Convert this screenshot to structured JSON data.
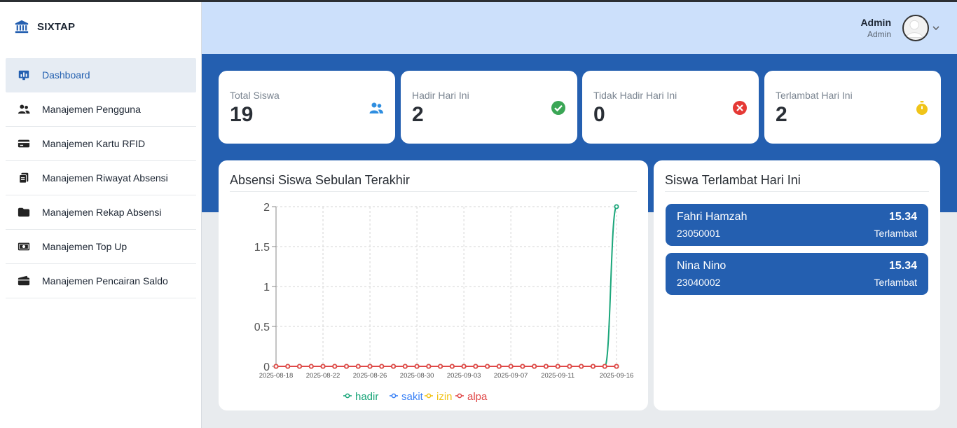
{
  "app": {
    "name": "SIXTAP"
  },
  "sidebar": {
    "items": [
      {
        "label": "Dashboard",
        "icon": "dashboard-chart-icon",
        "active": true
      },
      {
        "label": "Manajemen Pengguna",
        "icon": "users-icon"
      },
      {
        "label": "Manajemen Kartu RFID",
        "icon": "credit-card-icon"
      },
      {
        "label": "Manajemen Riwayat Absensi",
        "icon": "clipboard-history-icon"
      },
      {
        "label": "Manajemen Rekap Absensi",
        "icon": "folder-icon"
      },
      {
        "label": "Manajemen Top Up",
        "icon": "money-bill-icon"
      },
      {
        "label": "Manajemen Pencairan Saldo",
        "icon": "wallet-icon"
      }
    ]
  },
  "header": {
    "user_name": "Admin",
    "user_role": "Admin"
  },
  "stats": [
    {
      "label": "Total Siswa",
      "value": "19",
      "icon": "users-icon",
      "color": "#2f8ee0"
    },
    {
      "label": "Hadir Hari Ini",
      "value": "2",
      "icon": "check-circle-icon",
      "color": "#3aa655"
    },
    {
      "label": "Tidak Hadir Hari Ini",
      "value": "0",
      "icon": "x-circle-icon",
      "color": "#e53935"
    },
    {
      "label": "Terlambat Hari Ini",
      "value": "2",
      "icon": "stopwatch-icon",
      "color": "#f0c419"
    }
  ],
  "attendance_card": {
    "title": "Absensi Siswa Sebulan Terakhir"
  },
  "late_card": {
    "title": "Siswa Terlambat Hari Ini",
    "items": [
      {
        "name": "Fahri Hamzah",
        "id": "23050001",
        "time": "15.34",
        "status": "Terlambat"
      },
      {
        "name": "Nina Nino",
        "id": "23040002",
        "time": "15.34",
        "status": "Terlambat"
      }
    ]
  },
  "chart_data": {
    "type": "line",
    "title": "",
    "xlabel": "",
    "ylabel": "",
    "ylim": [
      0,
      2
    ],
    "y_ticks": [
      "0",
      "0.5",
      "1",
      "1.5",
      "2"
    ],
    "grid": true,
    "legend_position": "bottom",
    "x_tick_labels": [
      "2025-08-18",
      "2025-08-22",
      "2025-08-26",
      "2025-08-30",
      "2025-09-03",
      "2025-09-07",
      "2025-09-11",
      "2025-09-16"
    ],
    "x": [
      "2025-08-18",
      "2025-08-19",
      "2025-08-20",
      "2025-08-21",
      "2025-08-22",
      "2025-08-23",
      "2025-08-24",
      "2025-08-25",
      "2025-08-26",
      "2025-08-27",
      "2025-08-28",
      "2025-08-29",
      "2025-08-30",
      "2025-08-31",
      "2025-09-01",
      "2025-09-02",
      "2025-09-03",
      "2025-09-04",
      "2025-09-05",
      "2025-09-06",
      "2025-09-07",
      "2025-09-08",
      "2025-09-09",
      "2025-09-10",
      "2025-09-11",
      "2025-09-12",
      "2025-09-13",
      "2025-09-14",
      "2025-09-15",
      "2025-09-16"
    ],
    "series": [
      {
        "name": "hadir",
        "color": "#1aa67a",
        "values": [
          0,
          0,
          0,
          0,
          0,
          0,
          0,
          0,
          0,
          0,
          0,
          0,
          0,
          0,
          0,
          0,
          0,
          0,
          0,
          0,
          0,
          0,
          0,
          0,
          0,
          0,
          0,
          0,
          0,
          2
        ]
      },
      {
        "name": "sakit",
        "color": "#3b82f6",
        "values": [
          0,
          0,
          0,
          0,
          0,
          0,
          0,
          0,
          0,
          0,
          0,
          0,
          0,
          0,
          0,
          0,
          0,
          0,
          0,
          0,
          0,
          0,
          0,
          0,
          0,
          0,
          0,
          0,
          0,
          0
        ]
      },
      {
        "name": "izin",
        "color": "#f2c318",
        "values": [
          0,
          0,
          0,
          0,
          0,
          0,
          0,
          0,
          0,
          0,
          0,
          0,
          0,
          0,
          0,
          0,
          0,
          0,
          0,
          0,
          0,
          0,
          0,
          0,
          0,
          0,
          0,
          0,
          0,
          0
        ]
      },
      {
        "name": "alpa",
        "color": "#e04848",
        "values": [
          0,
          0,
          0,
          0,
          0,
          0,
          0,
          0,
          0,
          0,
          0,
          0,
          0,
          0,
          0,
          0,
          0,
          0,
          0,
          0,
          0,
          0,
          0,
          0,
          0,
          0,
          0,
          0,
          0,
          0
        ]
      }
    ]
  }
}
